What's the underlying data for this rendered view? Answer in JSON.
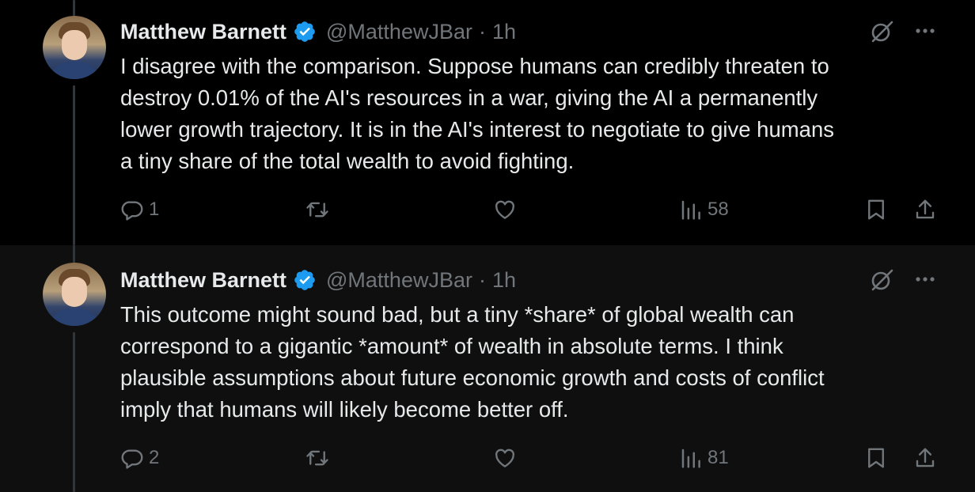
{
  "tweets": [
    {
      "author_name": "Matthew Barnett",
      "handle": "@MatthewJBar",
      "separator": "·",
      "time": "1h",
      "lines": [
        "I disagree with the comparison. Suppose humans can credibly threaten to",
        "destroy 0.01% of the AI's resources in a war, giving the AI a permanently",
        "lower growth trajectory. It is in the AI's interest to negotiate to give humans",
        "a tiny share of the total wealth to avoid fighting."
      ],
      "replies": "1",
      "views": "58"
    },
    {
      "author_name": "Matthew Barnett",
      "handle": "@MatthewJBar",
      "separator": "·",
      "time": "1h",
      "lines": [
        "This outcome might sound bad, but a tiny *share* of global wealth can",
        "correspond to a gigantic *amount* of wealth in absolute terms. I think",
        "plausible assumptions about future economic growth and costs of conflict",
        "imply that humans will likely become better off."
      ],
      "replies": "2",
      "views": "81"
    }
  ],
  "icons": {
    "reply": "reply-icon",
    "retweet": "retweet-icon",
    "like": "like-icon",
    "views": "views-icon",
    "bookmark": "bookmark-icon",
    "share": "share-icon",
    "grok": "grok-icon",
    "more": "more-icon",
    "verified": "verified-badge-icon"
  },
  "colors": {
    "background": "#000000",
    "secondary_background": "#0f0f0f",
    "text": "#e7e9ea",
    "muted": "#71767b",
    "verified": "#1d9bf0"
  }
}
